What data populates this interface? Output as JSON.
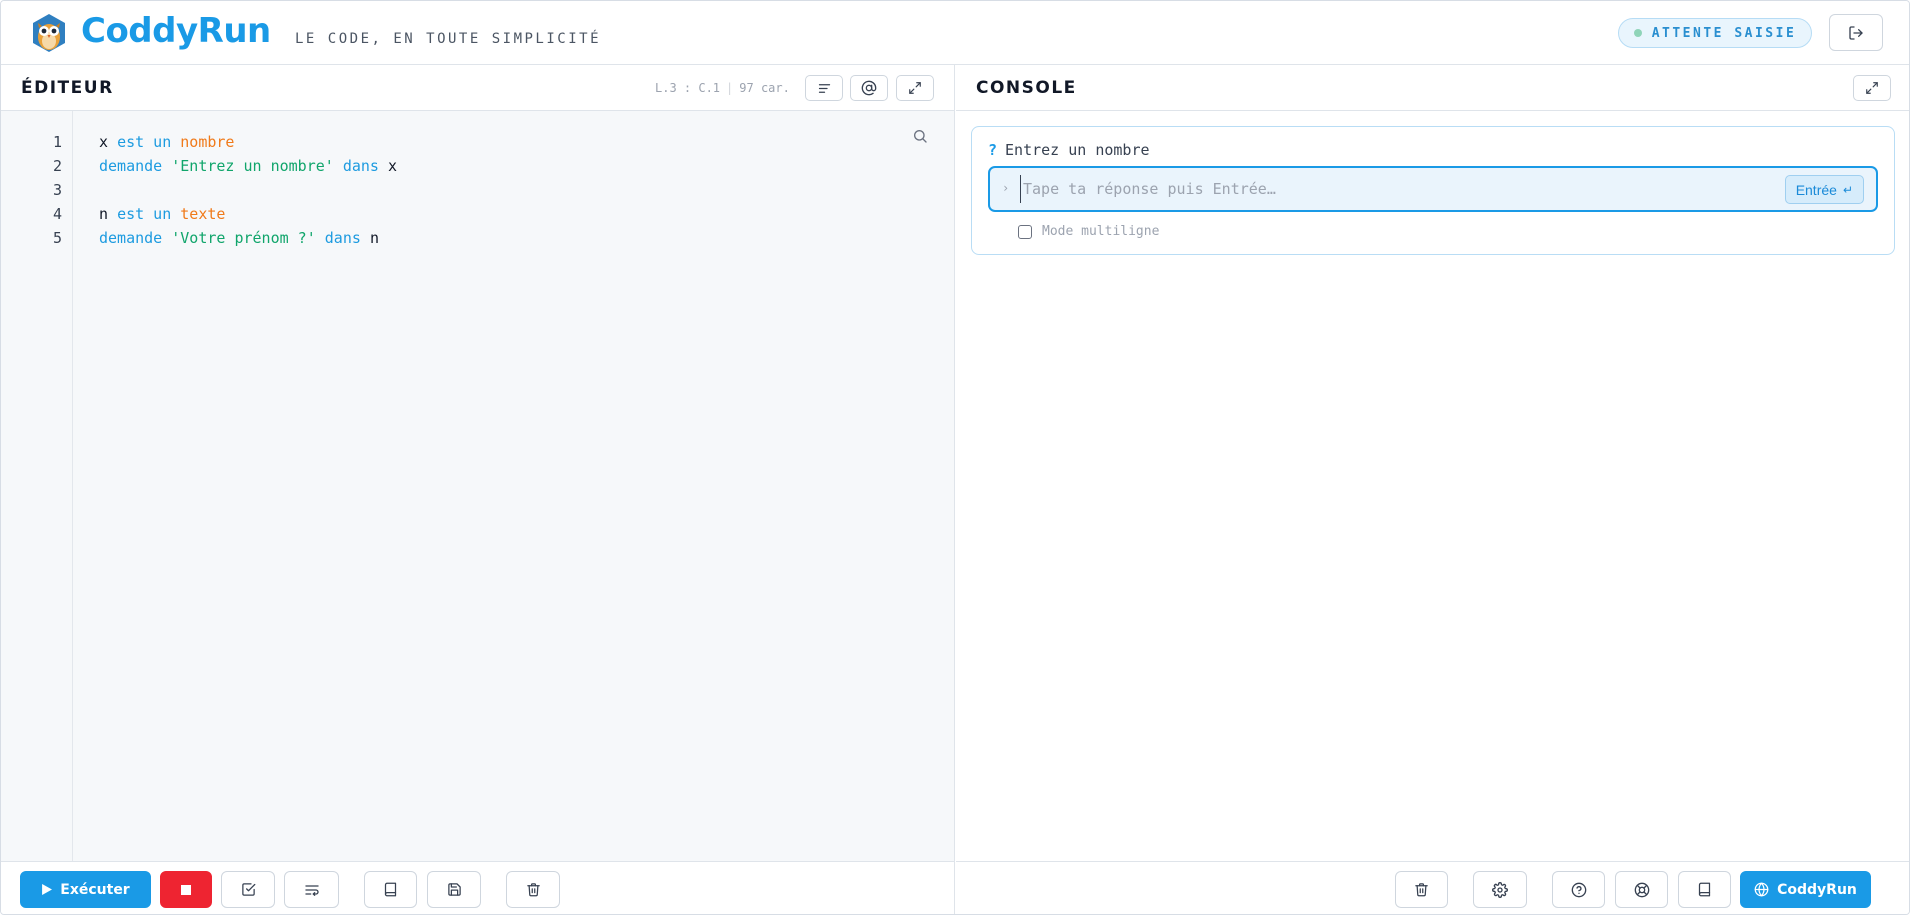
{
  "header": {
    "brand": "CoddyRun",
    "tagline": "LE CODE, EN TOUTE SIMPLICITÉ",
    "status": "ATTENTE SAISIE",
    "logo_icon": "owl-logo-icon",
    "logout_icon": "logout-icon"
  },
  "editor": {
    "title": "ÉDITEUR",
    "cursor": "L.3 : C.1",
    "chars": "97 car.",
    "line_numbers": [
      "1",
      "2",
      "3",
      "4",
      "5"
    ],
    "lines": [
      [
        {
          "t": "x ",
          "c": "id"
        },
        {
          "t": "est un ",
          "c": "kw"
        },
        {
          "t": "nombre",
          "c": "ty"
        }
      ],
      [
        {
          "t": "demande ",
          "c": "kw"
        },
        {
          "t": "'Entrez un nombre'",
          "c": "str"
        },
        {
          "t": " dans ",
          "c": "kw"
        },
        {
          "t": "x",
          "c": "id"
        }
      ],
      [],
      [
        {
          "t": "n ",
          "c": "id"
        },
        {
          "t": "est un ",
          "c": "kw"
        },
        {
          "t": "texte",
          "c": "ty"
        }
      ],
      [
        {
          "t": "demande ",
          "c": "kw"
        },
        {
          "t": "'Votre prénom ?'",
          "c": "str"
        },
        {
          "t": " dans ",
          "c": "kw"
        },
        {
          "t": "n",
          "c": "id"
        }
      ]
    ],
    "run_label": "Exécuter"
  },
  "console": {
    "title": "CONSOLE",
    "question": "Entrez un nombre",
    "question_mark": "?",
    "input_placeholder": "Tape ta réponse puis Entrée…",
    "enter_label": "Entrée",
    "enter_glyph": "↵",
    "multiline_label": "Mode multiligne",
    "brand_button": "CoddyRun"
  },
  "colors": {
    "accent": "#1a9ae6",
    "stop": "#ee2431",
    "keyword": "#1d9be0",
    "type": "#f07a1a",
    "string": "#10a56b"
  }
}
